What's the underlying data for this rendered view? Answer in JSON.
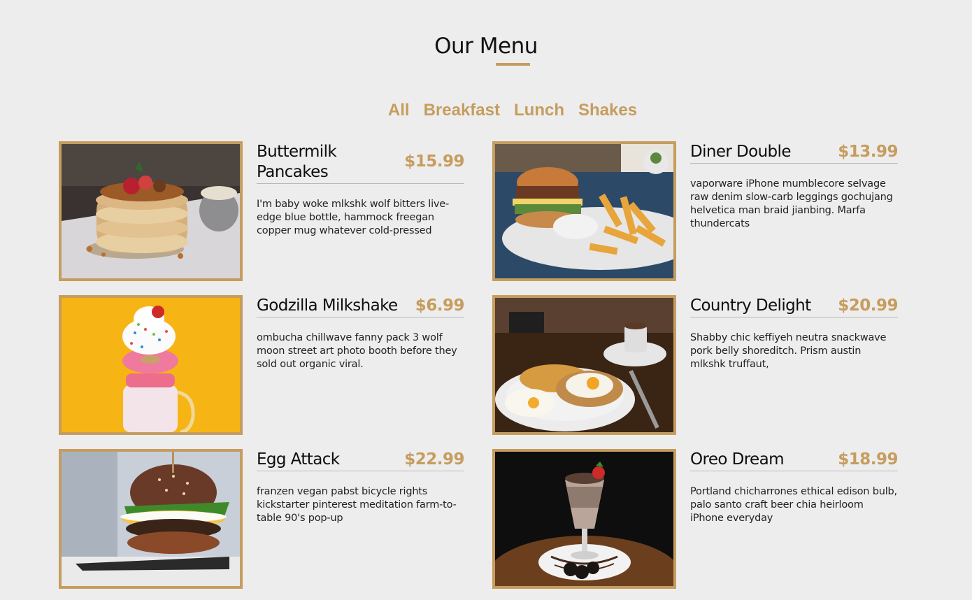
{
  "page": {
    "title": "Our Menu"
  },
  "filters": [
    "All",
    "Breakfast",
    "Lunch",
    "Shakes"
  ],
  "items": [
    {
      "name": "Buttermilk Pancakes",
      "price": "$15.99",
      "desc": "I'm baby woke mlkshk wolf bitters live-edge blue bottle, hammock freegan copper mug whatever cold-pressed",
      "image": "pancakes-photo"
    },
    {
      "name": "Diner Double",
      "price": "$13.99",
      "desc": "vaporware iPhone mumblecore selvage raw denim slow-carb leggings gochujang helvetica man braid jianbing. Marfa thundercats",
      "image": "burger-fries-photo"
    },
    {
      "name": "Godzilla Milkshake",
      "price": "$6.99",
      "desc": "ombucha chillwave fanny pack 3 wolf moon street art photo booth before they sold out organic viral.",
      "image": "milkshake-photo"
    },
    {
      "name": "Country Delight",
      "price": "$20.99",
      "desc": "Shabby chic keffiyeh neutra snackwave pork belly shoreditch. Prism austin mlkshk truffaut,",
      "image": "breakfast-plate-photo"
    },
    {
      "name": "Egg Attack",
      "price": "$22.99",
      "desc": "franzen vegan pabst bicycle rights kickstarter pinterest meditation farm-to-table 90's pop-up",
      "image": "egg-burger-photo"
    },
    {
      "name": "Oreo Dream",
      "price": "$18.99",
      "desc": "Portland chicharrones ethical edison bulb, palo santo craft beer chia heirloom iPhone everyday",
      "image": "oreo-shake-photo"
    }
  ],
  "colors": {
    "accent": "#c59d5f",
    "background": "#eeeded",
    "text": "#111111"
  }
}
